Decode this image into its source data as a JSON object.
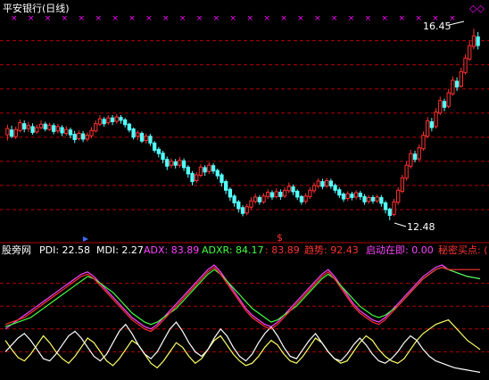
{
  "chart_data": [
    {
      "type": "candlestick",
      "title": "平安银行(日线)",
      "high_label": "16.45",
      "low_label": "12.48",
      "buy_marker": "$",
      "top_marker_glyph": "×",
      "top_marker_count": 27,
      "corner_marker": "◇◇",
      "ylim": [
        12.2,
        16.6
      ],
      "grid": true,
      "colors": {
        "up": "#ff3232",
        "down": "#54ffff",
        "grid": "#b00000",
        "marker": "#ff00ff",
        "label": "#ffffff"
      },
      "candles": [
        [
          14.25,
          14.38,
          14.13,
          14.46
        ],
        [
          14.35,
          14.22,
          14.18,
          14.44
        ],
        [
          14.21,
          14.36,
          14.16,
          14.42
        ],
        [
          14.34,
          14.5,
          14.3,
          14.57
        ],
        [
          14.48,
          14.37,
          14.3,
          14.55
        ],
        [
          14.38,
          14.44,
          14.31,
          14.52
        ],
        [
          14.42,
          14.3,
          14.25,
          14.49
        ],
        [
          14.31,
          14.4,
          14.27,
          14.46
        ],
        [
          14.4,
          14.47,
          14.36,
          14.55
        ],
        [
          14.47,
          14.37,
          14.32,
          14.52
        ],
        [
          14.36,
          14.45,
          14.33,
          14.5
        ],
        [
          14.44,
          14.32,
          14.26,
          14.49
        ],
        [
          14.33,
          14.42,
          14.28,
          14.48
        ],
        [
          14.4,
          14.29,
          14.22,
          14.45
        ],
        [
          14.28,
          14.36,
          14.23,
          14.43
        ],
        [
          14.35,
          14.25,
          14.18,
          14.4
        ],
        [
          14.26,
          14.15,
          14.08,
          14.33
        ],
        [
          14.17,
          14.28,
          14.13,
          14.34
        ],
        [
          14.27,
          14.16,
          14.1,
          14.33
        ],
        [
          14.16,
          14.24,
          14.11,
          14.3
        ],
        [
          14.23,
          14.34,
          14.18,
          14.41
        ],
        [
          14.33,
          14.48,
          14.3,
          14.55
        ],
        [
          14.47,
          14.58,
          14.43,
          14.66
        ],
        [
          14.57,
          14.48,
          14.42,
          14.62
        ],
        [
          14.5,
          14.6,
          14.46,
          14.66
        ],
        [
          14.6,
          14.52,
          14.45,
          14.66
        ],
        [
          14.53,
          14.62,
          14.48,
          14.68
        ],
        [
          14.61,
          14.55,
          14.48,
          14.66
        ],
        [
          14.56,
          14.46,
          14.4,
          14.6
        ],
        [
          14.47,
          14.35,
          14.3,
          14.5
        ],
        [
          14.37,
          14.2,
          14.15,
          14.4
        ],
        [
          14.22,
          14.29,
          14.14,
          14.34
        ],
        [
          14.28,
          14.12,
          14.08,
          14.32
        ],
        [
          14.13,
          14.22,
          14.07,
          14.28
        ],
        [
          14.22,
          14.08,
          14.02,
          14.27
        ],
        [
          14.08,
          13.93,
          13.88,
          14.12
        ],
        [
          13.95,
          13.86,
          13.78,
          14.0
        ],
        [
          13.87,
          13.74,
          13.66,
          13.92
        ],
        [
          13.74,
          13.6,
          13.52,
          13.8
        ],
        [
          13.62,
          13.7,
          13.56,
          13.76
        ],
        [
          13.69,
          13.62,
          13.55,
          13.75
        ],
        [
          13.62,
          13.72,
          13.57,
          13.79
        ],
        [
          13.71,
          13.57,
          13.5,
          13.76
        ],
        [
          13.58,
          13.44,
          13.36,
          13.62
        ],
        [
          13.45,
          13.28,
          13.2,
          13.5
        ],
        [
          13.3,
          13.42,
          13.25,
          13.48
        ],
        [
          13.41,
          13.58,
          13.37,
          13.64
        ],
        [
          13.57,
          13.48,
          13.4,
          13.62
        ],
        [
          13.49,
          13.62,
          13.44,
          13.68
        ],
        [
          13.61,
          13.5,
          13.44,
          13.66
        ],
        [
          13.51,
          13.4,
          13.33,
          13.55
        ],
        [
          13.42,
          13.26,
          13.18,
          13.46
        ],
        [
          13.28,
          13.1,
          13.02,
          13.32
        ],
        [
          13.12,
          12.96,
          12.88,
          13.16
        ],
        [
          12.98,
          12.84,
          12.76,
          13.02
        ],
        [
          12.86,
          12.72,
          12.64,
          12.9
        ],
        [
          12.74,
          12.62,
          12.56,
          12.79
        ],
        [
          12.63,
          12.76,
          12.58,
          12.82
        ],
        [
          12.75,
          12.88,
          12.7,
          12.96
        ],
        [
          12.87,
          12.96,
          12.82,
          13.03
        ],
        [
          12.95,
          12.86,
          12.8,
          13.0
        ],
        [
          12.86,
          12.98,
          12.82,
          13.04
        ],
        [
          12.97,
          13.06,
          12.92,
          13.12
        ],
        [
          13.05,
          12.96,
          12.9,
          13.1
        ],
        [
          12.97,
          13.07,
          12.93,
          13.14
        ],
        [
          13.06,
          12.97,
          12.9,
          13.12
        ],
        [
          12.98,
          13.1,
          12.94,
          13.16
        ],
        [
          13.09,
          13.18,
          13.04,
          13.26
        ],
        [
          13.17,
          13.07,
          13.0,
          13.22
        ],
        [
          13.08,
          12.96,
          12.9,
          13.12
        ],
        [
          12.97,
          12.86,
          12.8,
          13.0
        ],
        [
          12.87,
          12.98,
          12.82,
          13.04
        ],
        [
          12.97,
          13.1,
          12.92,
          13.16
        ],
        [
          13.09,
          13.2,
          13.04,
          13.26
        ],
        [
          13.19,
          13.29,
          13.14,
          13.35
        ],
        [
          13.28,
          13.18,
          13.12,
          13.34
        ],
        [
          13.19,
          13.3,
          13.15,
          13.36
        ],
        [
          13.29,
          13.19,
          13.13,
          13.34
        ],
        [
          13.2,
          13.1,
          13.04,
          13.24
        ],
        [
          13.11,
          13.0,
          12.94,
          13.16
        ],
        [
          13.02,
          12.92,
          12.86,
          13.06
        ],
        [
          12.93,
          13.03,
          12.88,
          13.08
        ],
        [
          13.02,
          12.95,
          12.89,
          13.07
        ],
        [
          12.96,
          13.05,
          12.91,
          13.1
        ],
        [
          13.04,
          12.97,
          12.9,
          13.09
        ],
        [
          12.97,
          12.86,
          12.8,
          13.02
        ],
        [
          12.87,
          12.95,
          12.82,
          13.0
        ],
        [
          12.95,
          12.88,
          12.82,
          13.0
        ],
        [
          12.88,
          12.96,
          12.84,
          13.01
        ],
        [
          12.95,
          12.83,
          12.76,
          13.0
        ],
        [
          12.84,
          12.7,
          12.62,
          12.88
        ],
        [
          12.71,
          12.58,
          12.48,
          12.74
        ],
        [
          12.6,
          12.86,
          12.56,
          12.92
        ],
        [
          12.85,
          13.1,
          12.8,
          13.16
        ],
        [
          13.08,
          13.36,
          13.04,
          13.42
        ],
        [
          13.35,
          13.62,
          13.3,
          13.7
        ],
        [
          13.6,
          13.86,
          13.55,
          13.94
        ],
        [
          13.85,
          13.74,
          13.68,
          13.92
        ],
        [
          13.75,
          13.98,
          13.7,
          14.05
        ],
        [
          13.96,
          14.24,
          13.92,
          14.32
        ],
        [
          14.22,
          14.54,
          14.18,
          14.62
        ],
        [
          14.52,
          14.4,
          14.32,
          14.6
        ],
        [
          14.42,
          14.72,
          14.38,
          14.8
        ],
        [
          14.7,
          14.96,
          14.66,
          15.04
        ],
        [
          14.94,
          14.82,
          14.74,
          15.0
        ],
        [
          14.84,
          15.12,
          14.8,
          15.2
        ],
        [
          15.1,
          15.38,
          15.06,
          15.46
        ],
        [
          15.36,
          15.24,
          15.16,
          15.44
        ],
        [
          15.26,
          15.56,
          15.22,
          15.64
        ],
        [
          15.54,
          15.84,
          15.5,
          15.92
        ],
        [
          15.82,
          16.1,
          15.78,
          16.2
        ],
        [
          16.08,
          16.3,
          16.02,
          16.45
        ],
        [
          16.28,
          16.1,
          16.02,
          16.38
        ]
      ]
    },
    {
      "type": "line",
      "title": "股旁网",
      "labels": {
        "pdi": "PDI: 22.58",
        "mdi": "MDI: 2.27",
        "adx": "ADX: 83.89",
        "adxr": "ADXR: 84.17",
        "v5": ": 83.89",
        "trend": "趋势: 92.43",
        "start": "启动在即: 0.00",
        "secret": "秘密买点: ("
      },
      "ylim": [
        0,
        100
      ],
      "series": [
        {
          "name": "PDI",
          "color": "#ffff66",
          "values": [
            30,
            22,
            15,
            12,
            18,
            26,
            34,
            28,
            20,
            14,
            10,
            16,
            24,
            32,
            28,
            20,
            12,
            8,
            14,
            22,
            30,
            26,
            18,
            10,
            6,
            12,
            20,
            28,
            24,
            16,
            10,
            14,
            22,
            30,
            34,
            26,
            18,
            12,
            8,
            10,
            16,
            24,
            30,
            26,
            18,
            12,
            10,
            16,
            24,
            32,
            28,
            20,
            14,
            10,
            12,
            20,
            28,
            34,
            30,
            22,
            16,
            12,
            10,
            14,
            22,
            30,
            36,
            40,
            44,
            46,
            48,
            42,
            36,
            30,
            26,
            22
          ]
        },
        {
          "name": "MDI",
          "color": "#ffffff",
          "values": [
            20,
            26,
            32,
            36,
            30,
            22,
            14,
            12,
            18,
            26,
            34,
            38,
            32,
            24,
            16,
            12,
            18,
            28,
            38,
            44,
            36,
            26,
            18,
            14,
            20,
            30,
            40,
            46,
            38,
            28,
            20,
            16,
            22,
            32,
            40,
            34,
            24,
            16,
            12,
            18,
            28,
            36,
            42,
            34,
            24,
            16,
            14,
            22,
            30,
            36,
            28,
            20,
            14,
            12,
            18,
            26,
            32,
            26,
            18,
            12,
            10,
            14,
            20,
            28,
            34,
            30,
            22,
            16,
            12,
            10,
            8,
            6,
            5,
            4,
            3,
            2
          ]
        },
        {
          "name": "ADX",
          "color": "#ff44ff",
          "values": [
            40,
            44,
            48,
            52,
            56,
            60,
            64,
            68,
            72,
            76,
            80,
            84,
            88,
            90,
            86,
            80,
            74,
            68,
            62,
            56,
            50,
            46,
            42,
            40,
            44,
            50,
            56,
            62,
            68,
            74,
            80,
            86,
            92,
            96,
            90,
            82,
            74,
            66,
            58,
            52,
            48,
            44,
            42,
            46,
            52,
            58,
            64,
            70,
            76,
            82,
            88,
            92,
            86,
            78,
            70,
            62,
            56,
            52,
            48,
            46,
            50,
            56,
            62,
            68,
            74,
            80,
            86,
            90,
            94,
            96,
            92,
            90,
            88,
            86,
            85,
            84
          ]
        },
        {
          "name": "ADXR",
          "color": "#44ff44",
          "values": [
            42,
            44,
            46,
            48,
            50,
            54,
            58,
            62,
            66,
            70,
            74,
            78,
            82,
            86,
            84,
            80,
            76,
            72,
            66,
            60,
            54,
            50,
            46,
            44,
            46,
            50,
            54,
            58,
            64,
            70,
            76,
            82,
            88,
            92,
            88,
            82,
            76,
            70,
            64,
            58,
            54,
            50,
            46,
            48,
            52,
            56,
            60,
            66,
            72,
            78,
            84,
            88,
            84,
            78,
            72,
            66,
            60,
            56,
            52,
            50,
            52,
            56,
            60,
            66,
            72,
            78,
            84,
            88,
            92,
            94,
            92,
            90,
            88,
            86,
            85,
            84
          ]
        },
        {
          "name": "趋势",
          "color": "#ff3232",
          "values": [
            44,
            46,
            48,
            50,
            54,
            58,
            62,
            66,
            70,
            74,
            78,
            82,
            86,
            88,
            84,
            78,
            72,
            66,
            60,
            54,
            48,
            44,
            40,
            38,
            42,
            48,
            54,
            60,
            66,
            72,
            78,
            84,
            90,
            94,
            88,
            80,
            72,
            64,
            56,
            50,
            46,
            42,
            40,
            44,
            50,
            56,
            62,
            68,
            74,
            80,
            86,
            90,
            84,
            76,
            68,
            60,
            54,
            50,
            46,
            44,
            48,
            54,
            60,
            66,
            72,
            78,
            84,
            88,
            92,
            94,
            92,
            92,
            92,
            92,
            92,
            92
          ]
        }
      ]
    }
  ]
}
